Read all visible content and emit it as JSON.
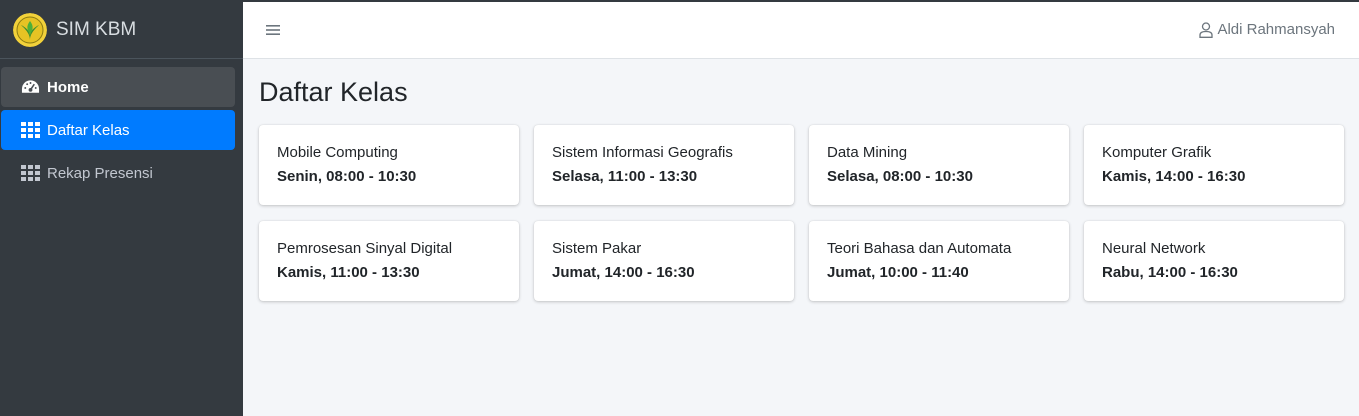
{
  "brand": {
    "name": "SIM KBM",
    "logo_icon": "green-leaf-emblem-icon"
  },
  "sidebar": {
    "items": [
      {
        "label": "Home",
        "icon": "dashboard-gauge-icon"
      },
      {
        "label": "Daftar Kelas",
        "icon": "grid-table-icon"
      },
      {
        "label": "Rekap Presensi",
        "icon": "grid-table-icon"
      }
    ]
  },
  "topbar": {
    "menu_icon": "hamburger-menu-icon",
    "user_name": "Aldi Rahmansyah",
    "user_icon": "user-outline-icon"
  },
  "main": {
    "title": "Daftar Kelas",
    "classes": [
      {
        "name": "Mobile Computing",
        "schedule": "Senin, 08:00 - 10:30"
      },
      {
        "name": "Sistem Informasi Geografis",
        "schedule": "Selasa, 11:00 - 13:30"
      },
      {
        "name": "Data Mining",
        "schedule": "Selasa, 08:00 - 10:30"
      },
      {
        "name": "Komputer Grafik",
        "schedule": "Kamis, 14:00 - 16:30"
      },
      {
        "name": "Pemrosesan Sinyal Digital",
        "schedule": "Kamis, 11:00 - 13:30"
      },
      {
        "name": "Sistem Pakar",
        "schedule": "Jumat, 14:00 - 16:30"
      },
      {
        "name": "Teori Bahasa dan Automata",
        "schedule": "Jumat, 10:00 - 11:40"
      },
      {
        "name": "Neural Network",
        "schedule": "Rabu, 14:00 - 16:30"
      }
    ]
  },
  "colors": {
    "sidebar_bg": "#343a40",
    "active": "#007bff",
    "page_bg": "#f4f6f9"
  }
}
